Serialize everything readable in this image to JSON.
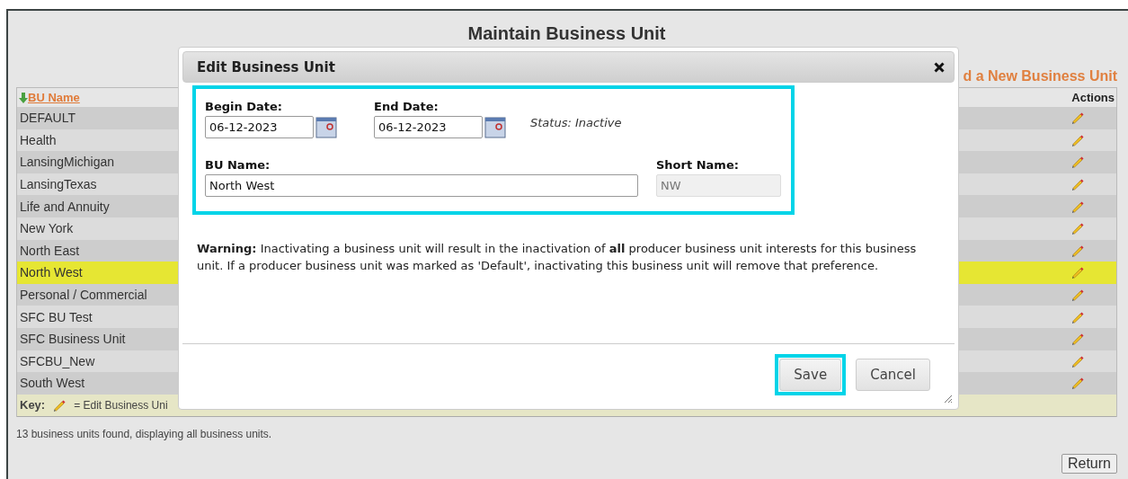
{
  "page": {
    "title": "Maintain Business Unit",
    "add_link": "d a New Business Unit",
    "table": {
      "columns": [
        {
          "label": "BU Name",
          "sorted": true
        },
        {
          "label": "Actions"
        }
      ],
      "rows": [
        {
          "name": "DEFAULT",
          "selected": false
        },
        {
          "name": "Health",
          "selected": false
        },
        {
          "name": "LansingMichigan",
          "selected": false
        },
        {
          "name": "LansingTexas",
          "selected": false
        },
        {
          "name": "Life and Annuity",
          "selected": false
        },
        {
          "name": "New York",
          "selected": false
        },
        {
          "name": "North East",
          "selected": false
        },
        {
          "name": "North West",
          "selected": true
        },
        {
          "name": "Personal / Commercial",
          "selected": false
        },
        {
          "name": "SFC BU Test",
          "selected": false
        },
        {
          "name": "SFC Business Unit",
          "selected": false
        },
        {
          "name": "SFCBU_New",
          "selected": false
        },
        {
          "name": "South West",
          "selected": false
        }
      ],
      "key": {
        "label": "Key:",
        "text": "= Edit Business Uni"
      }
    },
    "summary": "13 business units found, displaying all business units.",
    "return_button": "Return"
  },
  "dialog": {
    "title": "Edit Business Unit",
    "begin_date": {
      "label": "Begin Date:",
      "value": "06-12-2023"
    },
    "end_date": {
      "label": "End Date:",
      "value": "06-12-2023"
    },
    "status": "Status: Inactive",
    "bu_name": {
      "label": "BU Name:",
      "value": "North West"
    },
    "short_name": {
      "label": "Short Name:",
      "value": "NW",
      "disabled": true
    },
    "warning": "**Warning:** Inactivating a business unit will result in the inactivation of **all** producer business unit interests for this business unit. If a producer business unit was marked as 'Default', inactivating this business unit will remove that preference.",
    "buttons": [
      {
        "label": "Save",
        "highlighted": true
      },
      {
        "label": "Cancel",
        "highlighted": false
      }
    ]
  }
}
